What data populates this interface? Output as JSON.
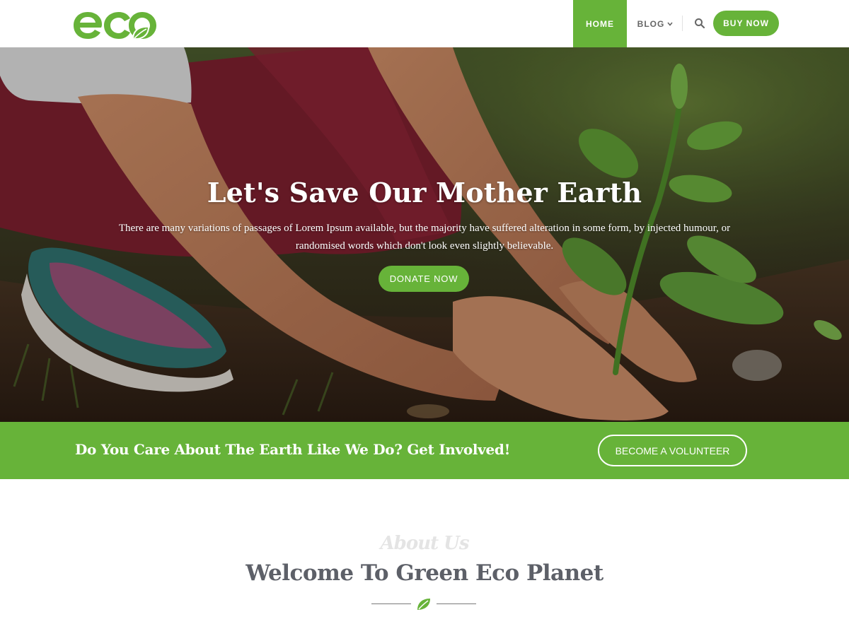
{
  "colors": {
    "accent": "#67b339",
    "heading": "#5d6068",
    "white": "#ffffff"
  },
  "header": {
    "logo_text": "eco",
    "logo_icon": "leaf-icon",
    "nav": {
      "home": "HOME",
      "blog": "BLOG",
      "blog_icon": "chevron-down-icon"
    },
    "search_icon": "search-icon",
    "buy_now": "BUY NOW"
  },
  "hero": {
    "title": "Let's Save Our Mother Earth",
    "subtitle": "There are many variations of passages of Lorem Ipsum available, but the majority have suffered alteration in some form, by injected humour, or randomised words which don't look even slightly believable.",
    "cta": "DONATE NOW"
  },
  "cta_band": {
    "text": "Do You Care About The Earth Like We Do? Get Involved!",
    "button": "BECOME A VOLUNTEER"
  },
  "about": {
    "script_label": "About Us",
    "title": "Welcome To Green Eco Planet",
    "separator_icon": "leaf-icon"
  }
}
